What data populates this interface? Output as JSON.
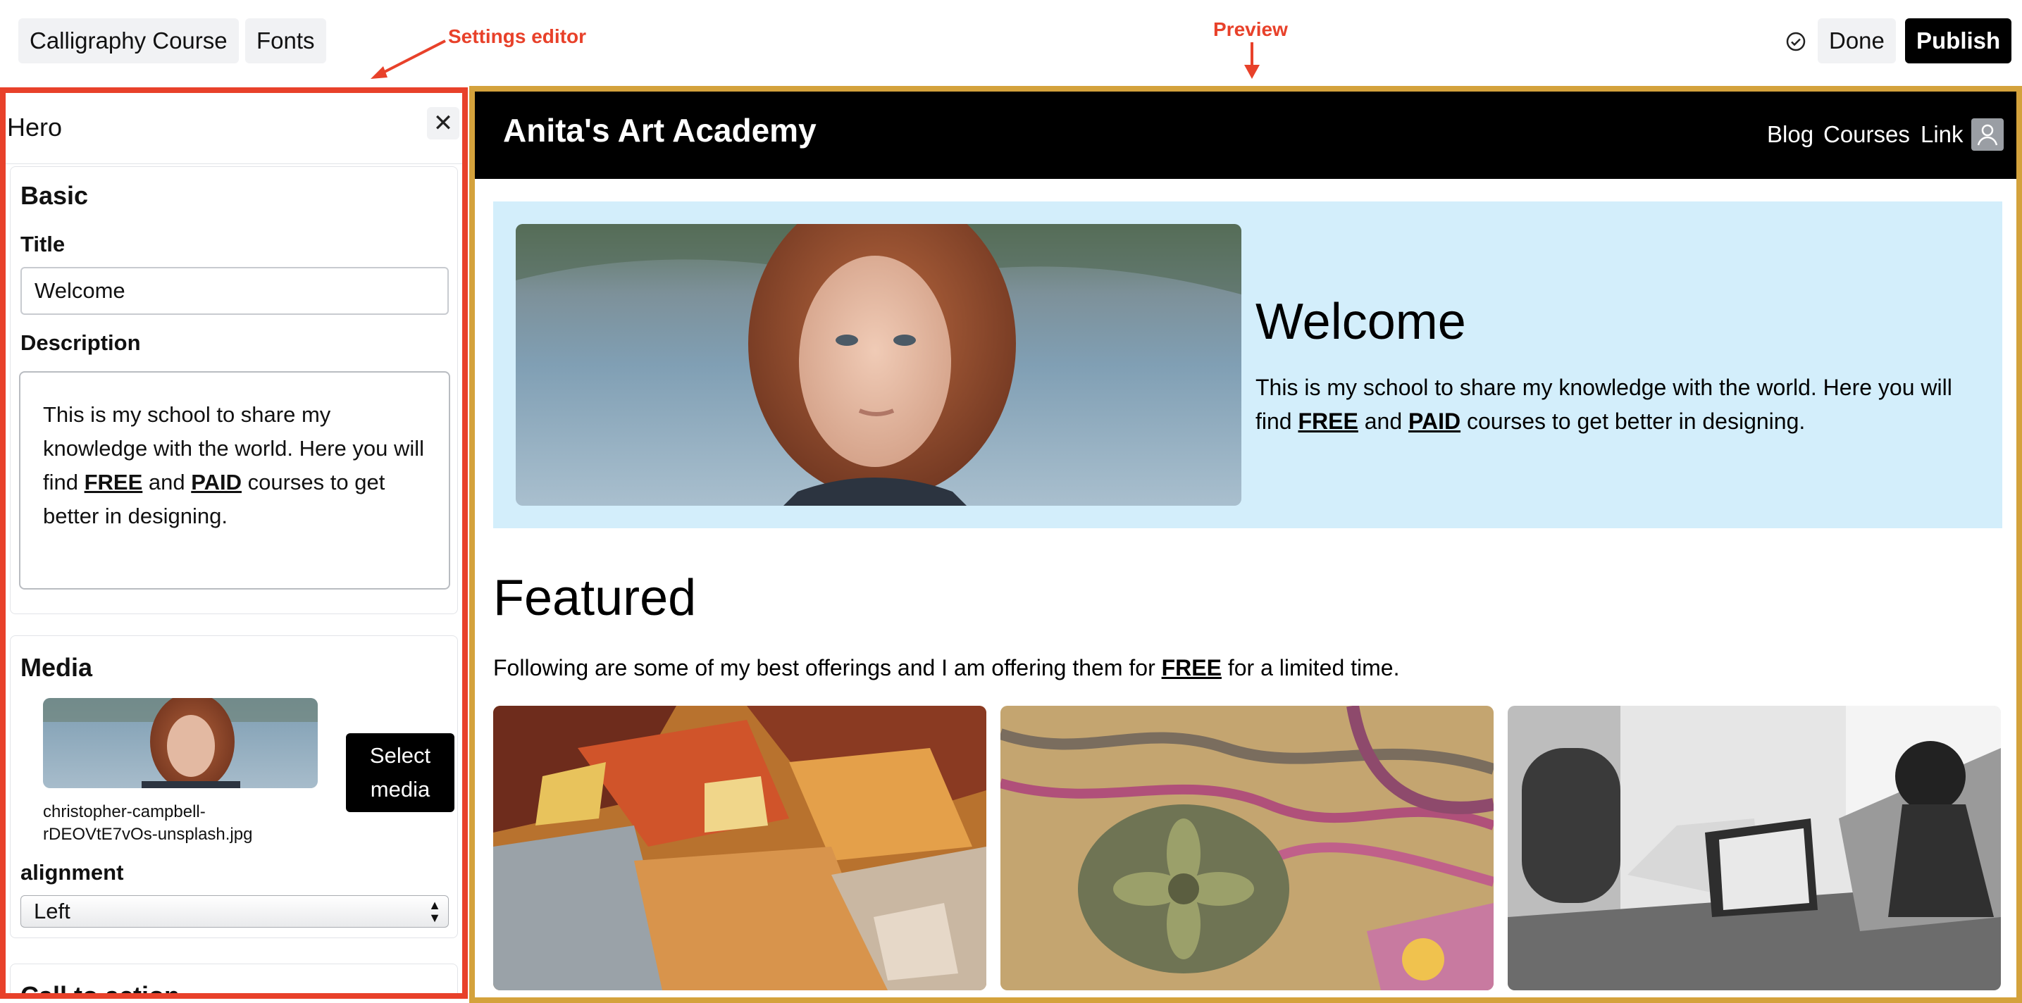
{
  "topbar": {
    "course_label": "Calligraphy Course",
    "fonts_label": "Fonts",
    "done_label": "Done",
    "publish_label": "Publish",
    "status_icon": "check-circle-icon"
  },
  "annotations": {
    "settings_editor": "Settings editor",
    "preview": "Preview"
  },
  "editor": {
    "panel_title": "Hero",
    "close_icon": "close-icon",
    "basic": {
      "heading": "Basic",
      "title_label": "Title",
      "title_value": "Welcome",
      "description_label": "Description",
      "description_parts": {
        "p1": "This is my school to share my knowledge with the world. Here you will find ",
        "b1": "FREE",
        "p2": " and ",
        "b2": "PAID",
        "p3": " courses to get better in designing."
      }
    },
    "media": {
      "heading": "Media",
      "select_label": "Select media",
      "filename": "christopher-campbell-rDEOVtE7vOs-unsplash.jpg",
      "alignment_label": "alignment",
      "alignment_value": "Left"
    },
    "cta": {
      "heading": "Call to action"
    }
  },
  "preview": {
    "brand": "Anita's Art Academy",
    "nav": [
      "Blog",
      "Courses",
      "Link"
    ],
    "hero": {
      "title": "Welcome",
      "p1": "This is my school to share my knowledge with the world. Here you will find ",
      "b1": "FREE",
      "p2": " and ",
      "b2": "PAID",
      "p3": " courses to get better in designing."
    },
    "featured": {
      "title": "Featured",
      "p1": "Following are some of my best offerings and I am offering them for ",
      "b1": "FREE",
      "p2": " for a limited time."
    }
  },
  "colors": {
    "editor_border": "#e8412a",
    "preview_border": "#d4a23c",
    "hero_bg": "#d3eefb",
    "nav_bg": "#000000"
  }
}
